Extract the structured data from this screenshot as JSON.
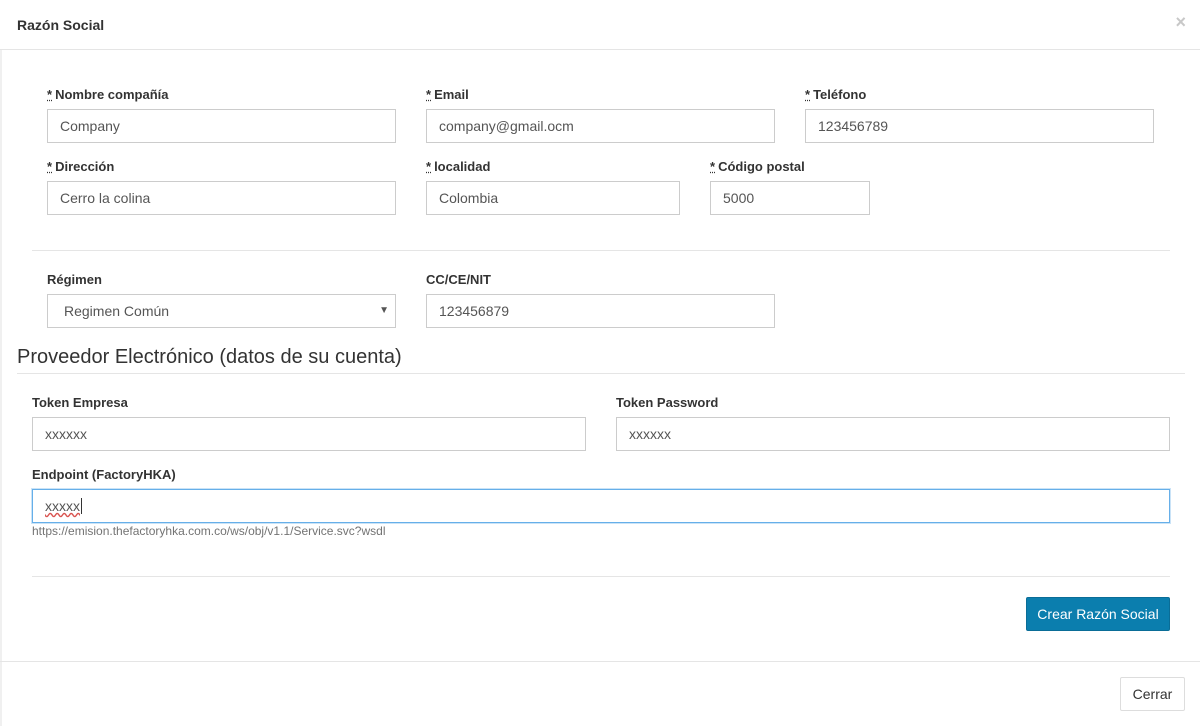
{
  "modal": {
    "title": "Razón Social",
    "close_glyph": "×"
  },
  "required_mark": "*",
  "fields": {
    "nombre": {
      "label": "Nombre compañía",
      "value": "Company"
    },
    "email": {
      "label": "Email",
      "value": "company@gmail.ocm"
    },
    "telefono": {
      "label": "Teléfono",
      "value": "123456789"
    },
    "direccion": {
      "label": "Dirección",
      "value": "Cerro la colina"
    },
    "localidad": {
      "label": "localidad",
      "value": "Colombia"
    },
    "codigo_postal": {
      "label": "Código postal",
      "value": "5000"
    },
    "regimen": {
      "label": "Régimen",
      "value": "Regimen Común"
    },
    "cc": {
      "label": "CC/CE/NIT",
      "value": "123456879"
    }
  },
  "provider": {
    "section_title": "Proveedor Electrónico (datos de su cuenta)",
    "token_empresa": {
      "label": "Token Empresa",
      "value": "xxxxxx"
    },
    "token_password": {
      "label": "Token Password",
      "value": "xxxxxx"
    },
    "endpoint": {
      "label": "Endpoint (FactoryHKA)",
      "value": "xxxxx",
      "help": "https://emision.thefactoryhka.com.co/ws/obj/v1.1/Service.svc?wsdl"
    }
  },
  "actions": {
    "create_label": "Crear Razón Social",
    "close_label": "Cerrar"
  },
  "colors": {
    "primary": "#0b7eae",
    "focus_border": "#66afe9"
  }
}
